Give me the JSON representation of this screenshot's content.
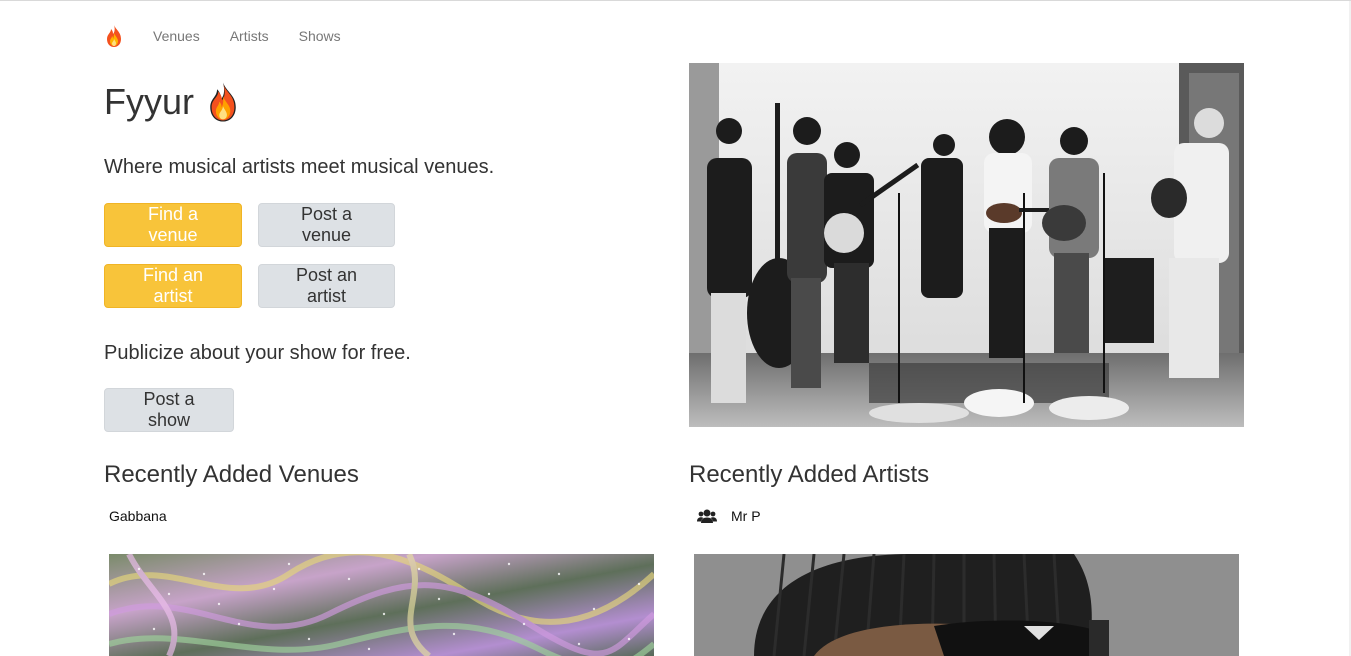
{
  "nav": {
    "logo_icon": "flame-icon",
    "links": [
      "Venues",
      "Artists",
      "Shows"
    ]
  },
  "hero": {
    "title": "Fyyur",
    "title_icon": "flame-icon",
    "tagline": "Where musical artists meet musical venues.",
    "buttons": {
      "find_venue": "Find a venue",
      "post_venue": "Post a venue",
      "find_artist": "Find an artist",
      "post_artist": "Post an artist",
      "post_show": "Post a show"
    },
    "publicize": "Publicize about your show for free.",
    "photo": "bluegrass-band-photo"
  },
  "recent_venues": {
    "title": "Recently Added Venues",
    "items": [
      {
        "name": "Gabbana",
        "image": "abstract-glitter-art"
      }
    ]
  },
  "recent_artists": {
    "title": "Recently Added Artists",
    "items": [
      {
        "name": "Mr P",
        "icon": "users-icon",
        "image": "artist-portrait"
      }
    ]
  },
  "colors": {
    "warning": "#f8c43a",
    "default_button": "#dde1e5",
    "text": "#333333",
    "nav_link": "#777777"
  }
}
